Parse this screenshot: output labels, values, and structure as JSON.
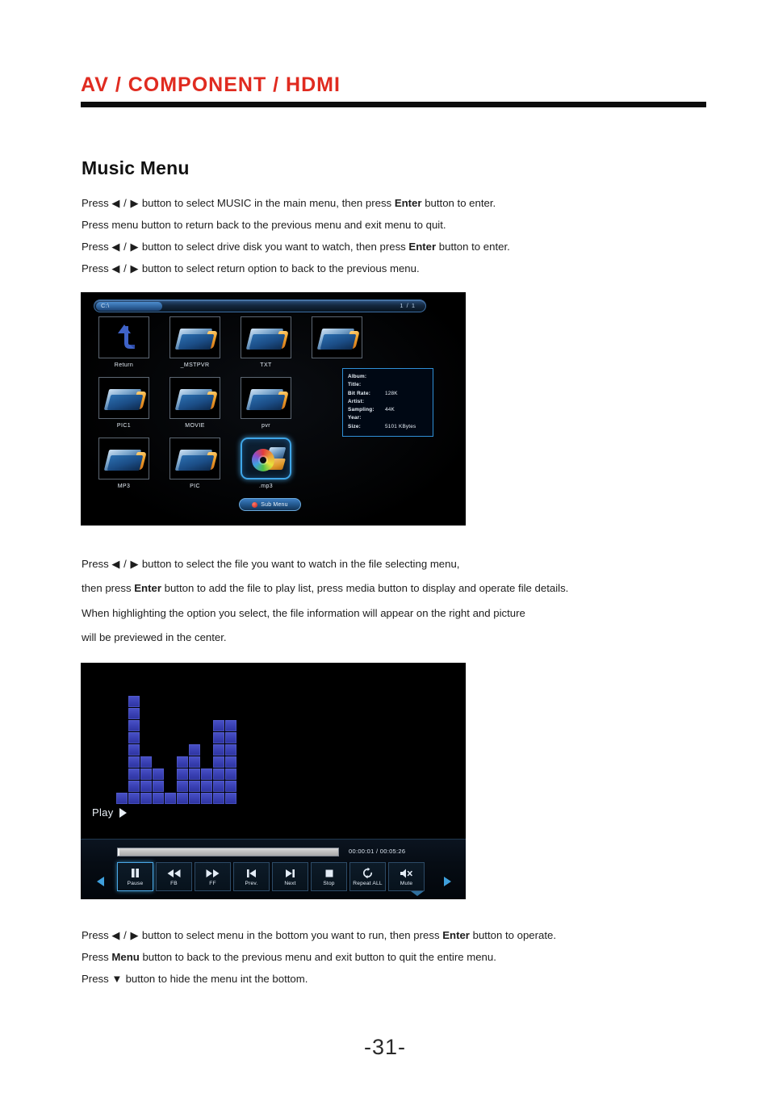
{
  "header": {
    "title": "AV / COMPONENT / HDMI",
    "rule_color": "#0d0d0d",
    "title_color": "#e02b20"
  },
  "section": {
    "title": "Music Menu"
  },
  "paragraphs": {
    "intro": [
      {
        "pre": "Press ",
        "arrows": "◀ / ▶",
        "mid": " button to select MUSIC in the main menu,  then press ",
        "bold": "Enter",
        "post": " button to enter."
      },
      {
        "pre": "Press menu button to return back to the previous menu and exit menu to quit.",
        "arrows": "",
        "mid": "",
        "bold": "",
        "post": ""
      },
      {
        "pre": "Press ",
        "arrows": "◀ / ▶",
        "mid": " button to select drive disk you want to watch, then press ",
        "bold": "Enter",
        "post": " button to enter."
      },
      {
        "pre": "Press ",
        "arrows": "◀ / ▶",
        "mid": " button to select return option to back to the previous menu.",
        "bold": "",
        "post": ""
      }
    ],
    "middle_a": [
      {
        "pre": "Press ",
        "arrows": "◀ / ▶",
        "mid": " button to select the file you want to watch in the file selecting  menu,",
        "bold": "",
        "post": ""
      },
      {
        "pre": "then press ",
        "arrows": "",
        "mid": "",
        "bold": "Enter",
        "post": " button to add the file to play list, press media button to display and operate file details."
      }
    ],
    "middle_b": [
      {
        "pre": "When highlighting the option you select, the file information will appear on the right and picture",
        "arrows": "",
        "mid": "",
        "bold": "",
        "post": ""
      },
      {
        "pre": "will be previewed in the center.",
        "arrows": "",
        "mid": "",
        "bold": "",
        "post": ""
      }
    ],
    "outro": [
      {
        "pre": "Press ",
        "arrows": "◀ / ▶",
        "mid": " button to select menu in the bottom you want to run, then press ",
        "bold": "Enter",
        "post": " button to operate."
      },
      {
        "pre": "Press ",
        "arrows": "",
        "mid": "",
        "bold": "Menu",
        "post": " button to back to the previous menu and exit button to quit the entire menu."
      },
      {
        "pre": "Press ",
        "arrows": "▼",
        "mid": " button to hide the menu int the bottom.",
        "bold": "",
        "post": ""
      }
    ]
  },
  "file_browser": {
    "path": "C:\\",
    "page_indicator": "1 / 1",
    "items": [
      {
        "label": "Return",
        "icon": "return-arrow-icon",
        "selected": false
      },
      {
        "label": "_MSTPVR",
        "icon": "folder-icon",
        "selected": false
      },
      {
        "label": "TXT",
        "icon": "folder-icon",
        "selected": false
      },
      {
        "label": "",
        "icon": "folder-icon",
        "selected": false
      },
      {
        "label": "PIC1",
        "icon": "folder-icon",
        "selected": false
      },
      {
        "label": "MOVIE",
        "icon": "folder-icon",
        "selected": false
      },
      {
        "label": "pvr",
        "icon": "folder-icon",
        "selected": false
      },
      {
        "label": "MP3",
        "icon": "folder-icon",
        "selected": false
      },
      {
        "label": "PIC",
        "icon": "folder-icon",
        "selected": false
      },
      {
        "label": ".mp3",
        "icon": "cd-music-icon",
        "selected": true
      }
    ],
    "info_panel": [
      {
        "key": "Album:",
        "value": ""
      },
      {
        "key": "Title:",
        "value": ""
      },
      {
        "key": "Bit Rate:",
        "value": "128K"
      },
      {
        "key": "Artist:",
        "value": ""
      },
      {
        "key": "Sampling:",
        "value": "44K"
      },
      {
        "key": "Year:",
        "value": ""
      },
      {
        "key": "Size:",
        "value": "5101 KBytes"
      }
    ],
    "sub_menu_label": "Sub Menu",
    "sub_menu_dot_color": "#c51f12"
  },
  "music_player": {
    "status_label": "Play",
    "time_display": "00:00:01 / 00:05:26",
    "elapsed": "00:00:01",
    "duration": "00:05:26",
    "progress_percent": 0.3,
    "equalizer_bars": [
      1,
      9,
      4,
      3,
      1,
      4,
      5,
      3,
      7,
      7
    ],
    "equalizer_max": 9,
    "equalizer_color": "#3a41b4",
    "controls": [
      {
        "label": "Pause",
        "icon": "pause-icon",
        "selected": true
      },
      {
        "label": "FB",
        "icon": "rewind-icon",
        "selected": false
      },
      {
        "label": "FF",
        "icon": "fastforward-icon",
        "selected": false
      },
      {
        "label": "Prev.",
        "icon": "previous-icon",
        "selected": false
      },
      {
        "label": "Next",
        "icon": "next-icon",
        "selected": false
      },
      {
        "label": "Stop",
        "icon": "stop-icon",
        "selected": false
      },
      {
        "label": "Repeat ALL",
        "icon": "repeat-icon",
        "selected": false
      },
      {
        "label": "Mute",
        "icon": "mute-icon",
        "selected": false
      }
    ]
  },
  "footer": {
    "page_number": "-31-"
  }
}
